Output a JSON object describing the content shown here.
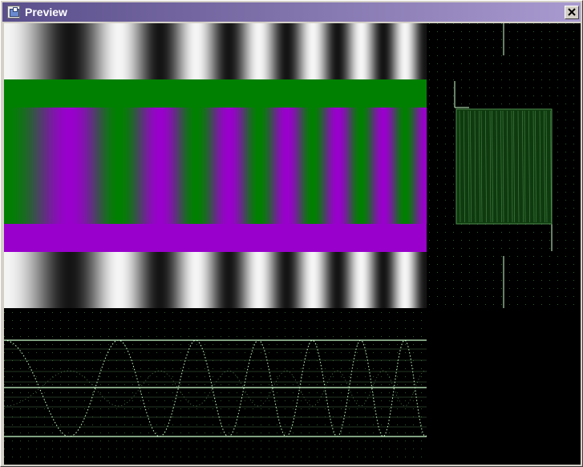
{
  "window": {
    "title": "Preview",
    "icon": "preview-app-icon",
    "close_icon": "close-icon"
  },
  "preview": {
    "panels": [
      "test-pattern-sweep",
      "vector-scope",
      "waveform-monitor"
    ],
    "colors": {
      "green": "#008000",
      "purple": "#9900cc",
      "trace": "#ccffcc",
      "grid": "#3a6a3a",
      "background": "#000000"
    }
  }
}
